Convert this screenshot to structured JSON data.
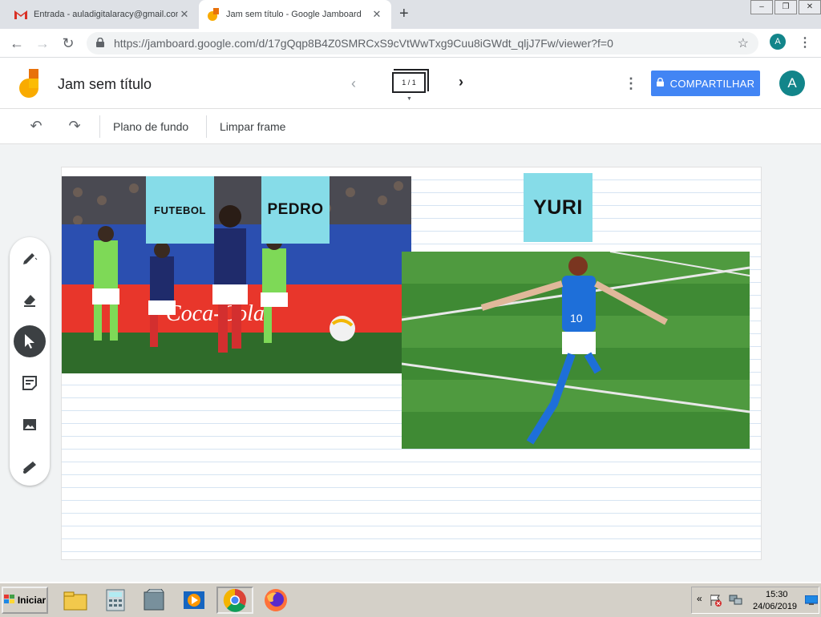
{
  "browser": {
    "tabs": [
      {
        "title": "Entrada - auladigitalaracy@gmail.com",
        "icon": "gmail-icon",
        "active": false
      },
      {
        "title": "Jam sem título - Google Jamboard",
        "icon": "jamboard-icon",
        "active": true
      }
    ],
    "url": "https://jamboard.google.com/d/17gQqp8B4Z0SMRCxS9cVtWwTxg9Cuu8iGWdt_qljJ7Fw/viewer?f=0",
    "profile_initial": "A"
  },
  "app": {
    "title": "Jam sem título",
    "frame_counter": "1 / 1",
    "share_label": "COMPARTILHAR",
    "avatar_initial": "A",
    "accent_color": "#4285f4",
    "avatar_color": "#12858a"
  },
  "toolbar": {
    "undo": "undo-icon",
    "redo": "redo-icon",
    "background_label": "Plano de fundo",
    "clear_label": "Limpar frame"
  },
  "board": {
    "stickies": [
      {
        "text": "FUTEBOL"
      },
      {
        "text": "PEDRO"
      },
      {
        "text": "YURI"
      }
    ],
    "sticky_color": "#86dce8"
  },
  "tools": [
    "pen-icon",
    "eraser-icon",
    "select-icon",
    "sticky-note-icon",
    "image-icon",
    "laser-icon"
  ],
  "taskbar": {
    "start_label": "Iniciar",
    "time": "15:30",
    "date": "24/06/2019"
  }
}
